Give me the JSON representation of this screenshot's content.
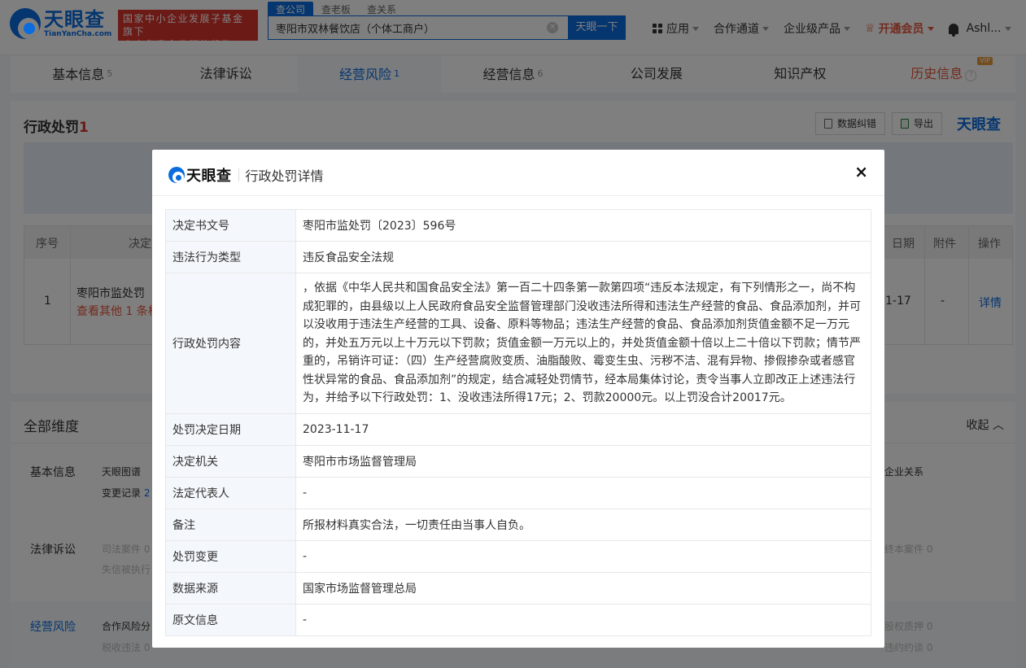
{
  "header": {
    "logo_cn": "天眼查",
    "logo_en": "TianYanCha.com",
    "gov_badge_line1": "国家中小企业发展子基金旗下",
    "gov_badge_line2": "官方备案企业征信机构",
    "search_tabs": [
      "查公司",
      "查老板",
      "查关系"
    ],
    "search_value": "枣阳市双林餐饮店（个体工商户）",
    "search_button": "天眼一下",
    "nav": {
      "apps": "应用",
      "partner": "合作通道",
      "enterprise": "企业级产品",
      "vip": "开通会员",
      "user": "Ashl..."
    }
  },
  "tabbar": {
    "items": [
      {
        "label": "基本信息",
        "count": "5"
      },
      {
        "label": "法律诉讼",
        "count": ""
      },
      {
        "label": "经营风险",
        "count": "1"
      },
      {
        "label": "经营信息",
        "count": "6"
      },
      {
        "label": "公司发展",
        "count": ""
      },
      {
        "label": "知识产权",
        "count": ""
      },
      {
        "label": "历史信息",
        "count": ""
      }
    ],
    "vip_tag": "VIP",
    "help": "?"
  },
  "panel": {
    "title": "行政处罚",
    "count": "1",
    "correct_button": "数据纠错",
    "export_button": "导出",
    "brand": "天眼查",
    "table_headers": {
      "index": "序号",
      "decision": "决定",
      "date": "日期",
      "attachment": "附件",
      "operation": "操作"
    },
    "row": {
      "index": "1",
      "name": "枣阳市监处罚 〔",
      "more": "查看其他 1 条相",
      "date": "1-17",
      "attachment": "-",
      "operation": "详情"
    }
  },
  "dims": {
    "title": "全部维度",
    "toggle": "收起",
    "basic_label": "基本信息",
    "basic_item1": "天眼图谱",
    "basic_item2": "变更记录",
    "basic_item2_count": "2",
    "basic_item_right": "企业关系",
    "legal_label": "法律诉讼",
    "legal_item1": "司法案件 0",
    "legal_item2": "失信被执行",
    "legal_item_right": "终本案件 0",
    "risk_label": "经营风险",
    "risk_item1": "合作风险分",
    "risk_item2": "税收违法 0",
    "risk_item_right1": "股权质押 0",
    "risk_item_right2": "违约约谈 0"
  },
  "modal": {
    "brand": "天眼查",
    "title": "行政处罚详情",
    "close": "×",
    "fields": [
      {
        "key": "决定书文号",
        "value": "枣阳市监处罚〔2023〕596号"
      },
      {
        "key": "违法行为类型",
        "value": "违反食品安全法规"
      },
      {
        "key": "行政处罚内容",
        "value": "，依据《中华人民共和国食品安全法》第一百二十四条第一款第四项“违反本法规定，有下列情形之一，尚不构成犯罪的，由县级以上人民政府食品安全监督管理部门没收违法所得和违法生产经营的食品、食品添加剂，并可以没收用于违法生产经营的工具、设备、原料等物品；违法生产经营的食品、食品添加剂货值金额不足一万元的，并处五万元以上十万元以下罚款；货值金额一万元以上的，并处货值金额十倍以上二十倍以下罚款；情节严重的，吊销许可证：（四）生产经营腐败变质、油脂酸败、霉变生虫、污秽不洁、混有异物、掺假掺杂或者感官性状异常的食品、食品添加剂”的规定，结合减轻处罚情节，经本局集体讨论，责令当事人立即改正上述违法行为，并给予以下行政处罚：1、没收违法所得17元；2、罚款20000元。以上罚没合计20017元。"
      },
      {
        "key": "处罚决定日期",
        "value": "2023-11-17"
      },
      {
        "key": "决定机关",
        "value": "枣阳市市场监督管理局"
      },
      {
        "key": "法定代表人",
        "value": "-"
      },
      {
        "key": "备注",
        "value": "所报材料真实合法，一切责任由当事人自负。"
      },
      {
        "key": "处罚变更",
        "value": "-"
      },
      {
        "key": "数据来源",
        "value": "国家市场监督管理总局"
      },
      {
        "key": "原文信息",
        "value": "-"
      }
    ]
  },
  "colors": {
    "brand_blue": "#0a6cde",
    "alert_red": "#d9352c",
    "vip_orange": "#e4573a"
  }
}
